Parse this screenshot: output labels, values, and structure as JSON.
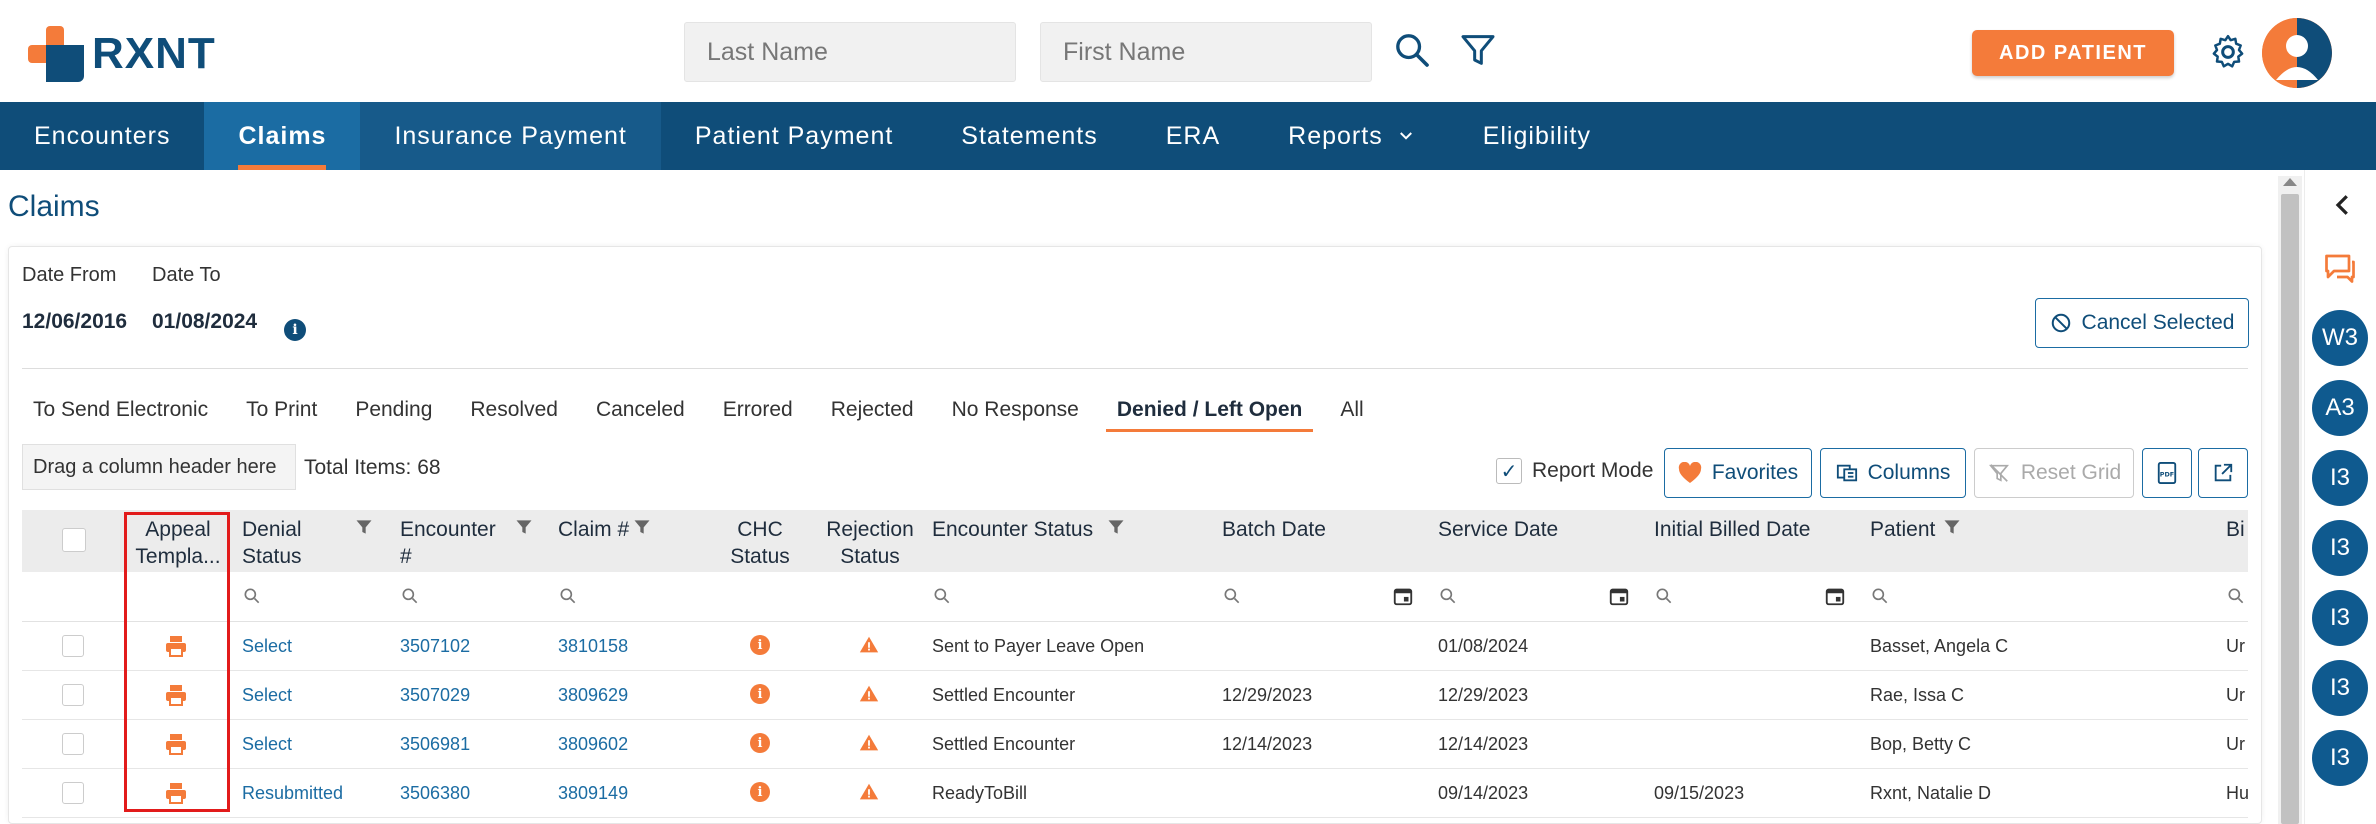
{
  "app": {
    "logo_text": "RXNT"
  },
  "search": {
    "last_name_placeholder": "Last Name",
    "first_name_placeholder": "First Name"
  },
  "header": {
    "add_patient_label": "ADD PATIENT"
  },
  "nav": {
    "items": [
      "Encounters",
      "Claims",
      "Insurance Payment",
      "Patient Payment",
      "Statements",
      "ERA",
      "Reports",
      "Eligibility"
    ],
    "active": "Claims"
  },
  "page": {
    "title": "Claims"
  },
  "filters": {
    "date_from_label": "Date From",
    "date_to_label": "Date To",
    "date_from": "12/06/2016",
    "date_to": "01/08/2024",
    "cancel_selected_label": "Cancel Selected"
  },
  "tabs": [
    "To Send Electronic",
    "To Print",
    "Pending",
    "Resolved",
    "Canceled",
    "Errored",
    "Rejected",
    "No Response",
    "Denied / Left Open",
    "All"
  ],
  "active_tab": "Denied / Left Open",
  "toolbar": {
    "grouping_hint": "Drag a column header here",
    "total_items": "Total Items: 68",
    "report_mode_label": "Report Mode",
    "report_mode_checked": true,
    "favorites_label": "Favorites",
    "columns_label": "Columns",
    "reset_grid_label": "Reset Grid"
  },
  "grid": {
    "columns": [
      "Appeal Templa...",
      "Denial Status",
      "Encounter #",
      "Claim #",
      "CHC Status",
      "Rejection Status",
      "Encounter Status",
      "Batch Date",
      "Service Date",
      "Initial Billed Date",
      "Patient",
      "Bi"
    ],
    "rows": [
      {
        "denial_status": "Select",
        "encounter": "3507102",
        "claim": "3810158",
        "encounter_status": "Sent to Payer Leave Open",
        "batch_date": "",
        "service_date": "01/08/2024",
        "initial_billed_date": "",
        "patient": "Basset, Angela C",
        "bi": "Ur"
      },
      {
        "denial_status": "Select",
        "encounter": "3507029",
        "claim": "3809629",
        "encounter_status": "Settled Encounter",
        "batch_date": "12/29/2023",
        "service_date": "12/29/2023",
        "initial_billed_date": "",
        "patient": "Rae, Issa C",
        "bi": "Ur"
      },
      {
        "denial_status": "Select",
        "encounter": "3506981",
        "claim": "3809602",
        "encounter_status": "Settled Encounter",
        "batch_date": "12/14/2023",
        "service_date": "12/14/2023",
        "initial_billed_date": "",
        "patient": "Bop, Betty C",
        "bi": "Ur"
      },
      {
        "denial_status": "Resubmitted",
        "encounter": "3506380",
        "claim": "3809149",
        "encounter_status": "ReadyToBill",
        "batch_date": "",
        "service_date": "09/14/2023",
        "initial_billed_date": "09/15/2023",
        "patient": "Rxnt, Natalie D",
        "bi": "Hu"
      }
    ]
  },
  "side_rail": {
    "bubbles": [
      "W3",
      "A3",
      "I3",
      "I3",
      "I3",
      "I3",
      "I3"
    ]
  },
  "colors": {
    "brand_navy": "#0f4d79",
    "accent_orange": "#f47b3a",
    "highlight_red": "#e21b1b"
  }
}
